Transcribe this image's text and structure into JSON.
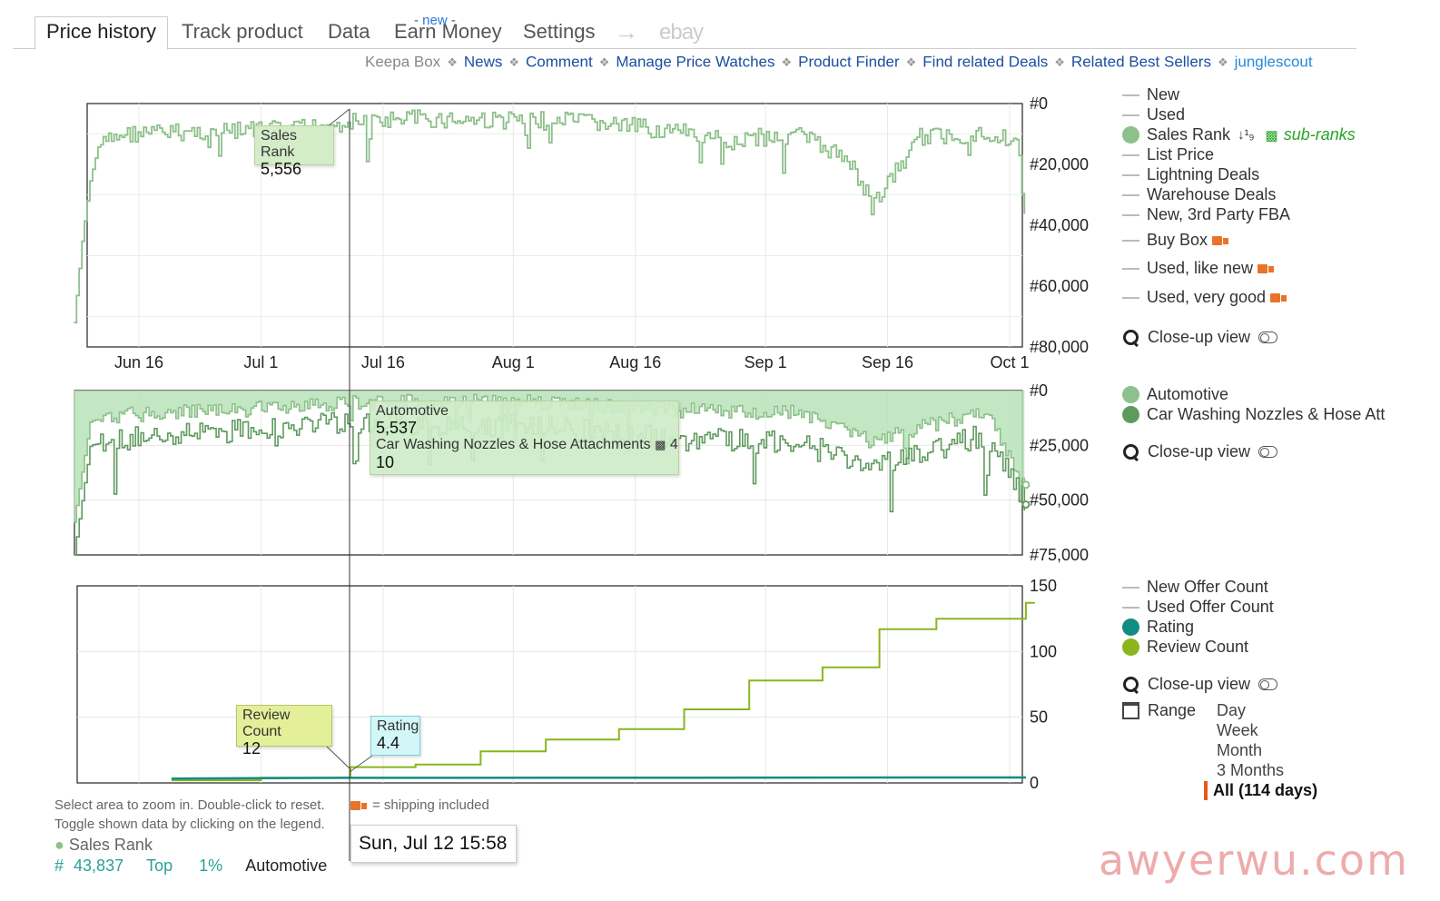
{
  "tabs": {
    "price_history": "Price history",
    "track_product": "Track product",
    "data": "Data",
    "earn_money": "Earn Money",
    "earn_money_badge": "new",
    "settings": "Settings",
    "ebay": "ebay"
  },
  "sublinks": {
    "keepa_box": "Keepa Box",
    "news": "News",
    "comment": "Comment",
    "manage_price_watches": "Manage Price Watches",
    "product_finder": "Product Finder",
    "find_related_deals": "Find related Deals",
    "related_best_sellers": "Related Best Sellers",
    "junglescout": "junglescout"
  },
  "legend_top": {
    "new": "New",
    "used": "Used",
    "sales_rank": "Sales Rank",
    "sub_ranks": "sub-ranks",
    "list_price": "List Price",
    "lightning_deals": "Lightning Deals",
    "warehouse_deals": "Warehouse Deals",
    "new_3rd_party_fba": "New, 3rd Party FBA",
    "buy_box": "Buy Box",
    "used_like_new": "Used, like new",
    "used_very_good": "Used, very good",
    "close_up_view": "Close-up view"
  },
  "legend_mid": {
    "automotive": "Automotive",
    "car_washing": "Car Washing Nozzles & Hose Att",
    "close_up_view": "Close-up view"
  },
  "legend_bottom": {
    "new_offer_count": "New Offer Count",
    "used_offer_count": "Used Offer Count",
    "rating": "Rating",
    "review_count": "Review Count",
    "close_up_view": "Close-up view",
    "range_label": "Range",
    "range_options": [
      "Day",
      "Week",
      "Month",
      "3 Months"
    ],
    "range_selected": "All (114 days)"
  },
  "tooltips": {
    "sales_rank_label": "Sales Rank",
    "sales_rank_value": "5,556",
    "automotive_label": "Automotive",
    "automotive_value": "5,537",
    "subcategory_label": "Car Washing Nozzles & Hose Attachments",
    "subcategory_level": "4",
    "subcategory_value": "10",
    "review_count_label": "Review Count",
    "review_count_value": "12",
    "rating_label": "Rating",
    "rating_value": "4.4"
  },
  "info": {
    "zoom_hint": "Select area to zoom in. Double-click to reset.",
    "toggle_hint": "Toggle shown data by clicking on the legend.",
    "shipping_note": "= shipping included",
    "date_readout": "Sun, Jul 12 15:58",
    "bottom_series": "Sales Rank",
    "bottom_hash": "#",
    "bottom_rank": "43,837",
    "bottom_top": "Top",
    "bottom_pct": "1%",
    "bottom_category": "Automotive"
  },
  "watermark": "awyerwu.com",
  "colors": {
    "sales_rank": "#8dc08a",
    "automotive": "#8dc08a",
    "subcategory": "#5e9a5e",
    "rating": "#118c82",
    "review_count": "#8ab51d",
    "link": "#1a4fa0",
    "selected_marker": "#e8581a"
  },
  "chart_data": [
    {
      "type": "line",
      "x_ticks": [
        "Jun 16",
        "Jul 1",
        "Jul 16",
        "Aug 1",
        "Aug 16",
        "Sep 1",
        "Sep 16",
        "Oct 1"
      ],
      "y_ticks": [
        "#0",
        "#20,000",
        "#40,000",
        "#60,000",
        "#80,000"
      ],
      "ylim": [
        80000,
        0
      ],
      "series": [
        {
          "name": "Sales Rank",
          "x": [
            "Jun 8",
            "Jun 9",
            "Jun 10",
            "Jun 11",
            "Jun 14",
            "Jun 20",
            "Jun 28",
            "Jul 5",
            "Jul 12",
            "Jul 20",
            "Aug 1",
            "Aug 10",
            "Aug 20",
            "Aug 28",
            "Sep 5",
            "Sep 12",
            "Sep 14",
            "Sep 20",
            "Sep 28",
            "Oct 2",
            "Oct 3"
          ],
          "values": [
            72000,
            45000,
            25000,
            14000,
            10000,
            9500,
            9000,
            8500,
            6000,
            5000,
            5500,
            6000,
            9000,
            12000,
            10000,
            20000,
            34000,
            11000,
            10000,
            12000,
            45000
          ]
        }
      ]
    },
    {
      "type": "area",
      "y_ticks": [
        "#0",
        "#25,000",
        "#50,000",
        "#75,000"
      ],
      "ylim": [
        75000,
        0
      ],
      "series": [
        {
          "name": "Automotive",
          "x": [
            "Jun 8",
            "Jun 10",
            "Jun 14",
            "Jun 28",
            "Jul 12",
            "Aug 1",
            "Aug 20",
            "Sep 5",
            "Sep 14",
            "Sep 28",
            "Oct 3"
          ],
          "values": [
            60000,
            14000,
            11000,
            9000,
            5537,
            5000,
            9000,
            10000,
            22000,
            10000,
            43000
          ]
        },
        {
          "name": "Car Washing Nozzles & Hose Att",
          "x": [
            "Jun 8",
            "Jun 10",
            "Jun 14",
            "Jun 28",
            "Jul 12",
            "Aug 1",
            "Aug 20",
            "Sep 5",
            "Sep 14",
            "Sep 28",
            "Oct 3"
          ],
          "values": [
            75000,
            25000,
            22000,
            18000,
            15000,
            16000,
            22000,
            24000,
            35000,
            20000,
            52000
          ]
        }
      ]
    },
    {
      "type": "line",
      "y_ticks": [
        "150",
        "100",
        "50",
        "0"
      ],
      "ylim": [
        0,
        150
      ],
      "series": [
        {
          "name": "Review Count",
          "x": [
            "Jun 20",
            "Jul 1",
            "Jul 12",
            "Jul 20",
            "Jul 28",
            "Aug 5",
            "Aug 14",
            "Aug 22",
            "Aug 30",
            "Sep 8",
            "Sep 15",
            "Sep 22",
            "Oct 3"
          ],
          "values": [
            2,
            4,
            12,
            14,
            24,
            33,
            41,
            56,
            78,
            88,
            117,
            125,
            137
          ]
        },
        {
          "name": "Rating",
          "x": [
            "Jun 20",
            "Jul 12",
            "Oct 3"
          ],
          "values": [
            4.2,
            4.4,
            4.5
          ]
        }
      ]
    }
  ]
}
